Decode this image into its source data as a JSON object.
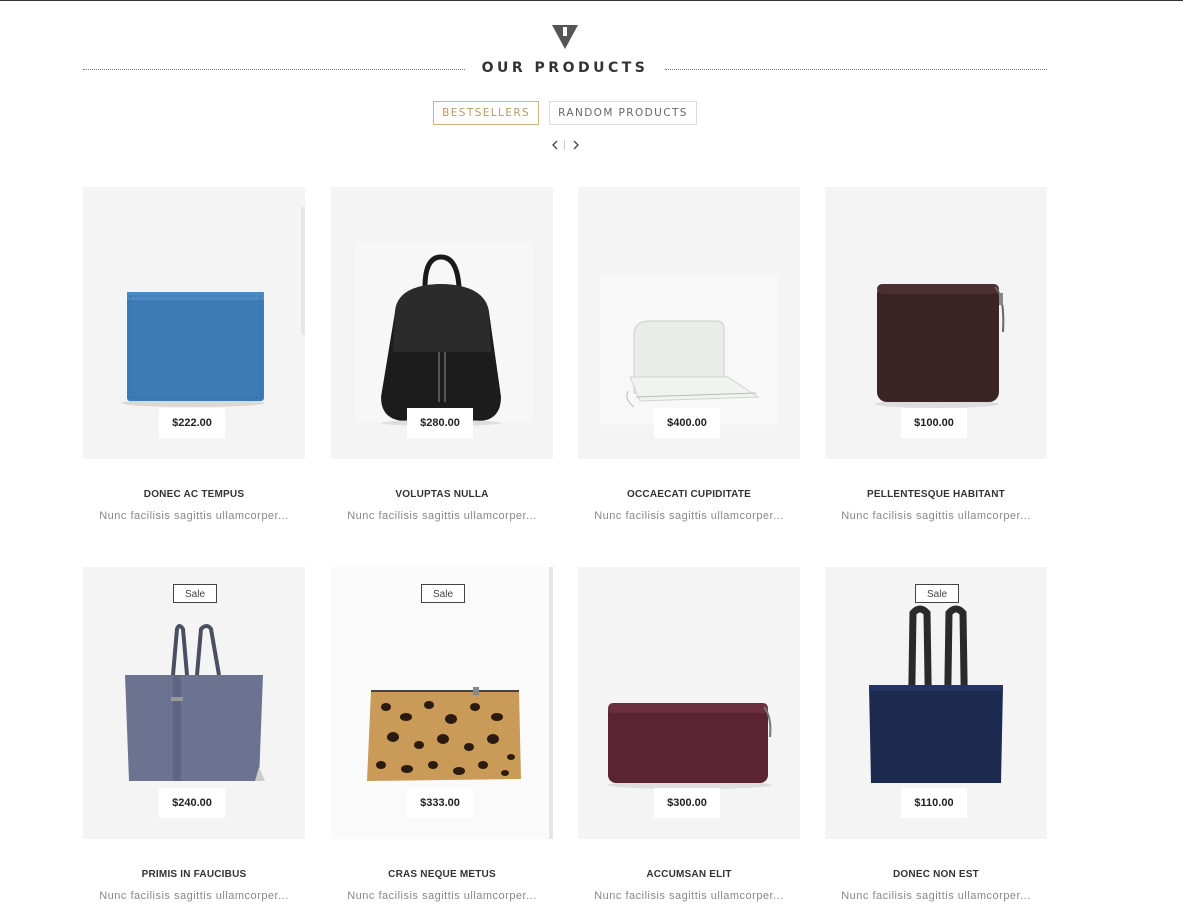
{
  "section": {
    "title": "OUR PRODUCTS",
    "logo_icon": "triangle-mark-icon"
  },
  "tabs": [
    {
      "label": "BESTSELLERS",
      "active": true
    },
    {
      "label": "RANDOM PRODUCTS",
      "active": false
    }
  ],
  "pager": {
    "prev_icon": "chevron-left-icon",
    "next_icon": "chevron-right-icon"
  },
  "colors": {
    "accent": "#cdb487",
    "card_bg": "#f4f4f4",
    "text_dark": "#333333",
    "text_muted": "#888888"
  },
  "products": [
    {
      "name": "DONEC AC TEMPUS",
      "desc": "Nunc facilisis sagittis ullamcorper...",
      "price": "$222.00",
      "sale": null,
      "image": "blue-wallet"
    },
    {
      "name": "VOLUPTAS NULLA",
      "desc": "Nunc facilisis sagittis ullamcorper...",
      "price": "$280.00",
      "sale": null,
      "image": "black-backpack"
    },
    {
      "name": "OCCAECATI CUPIDITATE",
      "desc": "Nunc facilisis sagittis ullamcorper...",
      "price": "$400.00",
      "sale": null,
      "image": "white-clutch-wallet"
    },
    {
      "name": "PELLENTESQUE HABITANT",
      "desc": "Nunc facilisis sagittis ullamcorper...",
      "price": "$100.00",
      "sale": null,
      "image": "brown-zip-wallet"
    },
    {
      "name": "PRIMIS IN FAUCIBUS",
      "desc": "Nunc facilisis sagittis ullamcorper...",
      "price": "$240.00",
      "sale": "Sale",
      "image": "grey-tote-bag"
    },
    {
      "name": "CRAS NEQUE METUS",
      "desc": "Nunc facilisis sagittis ullamcorper...",
      "price": "$333.00",
      "sale": "Sale",
      "image": "leopard-pouch"
    },
    {
      "name": "ACCUMSAN ELIT",
      "desc": "Nunc facilisis sagittis ullamcorper...",
      "price": "$300.00",
      "sale": null,
      "image": "burgundy-long-wallet"
    },
    {
      "name": "DONEC NON EST",
      "desc": "Nunc facilisis sagittis ullamcorper...",
      "price": "$110.00",
      "sale": "Sale",
      "image": "navy-tote-bag"
    }
  ]
}
